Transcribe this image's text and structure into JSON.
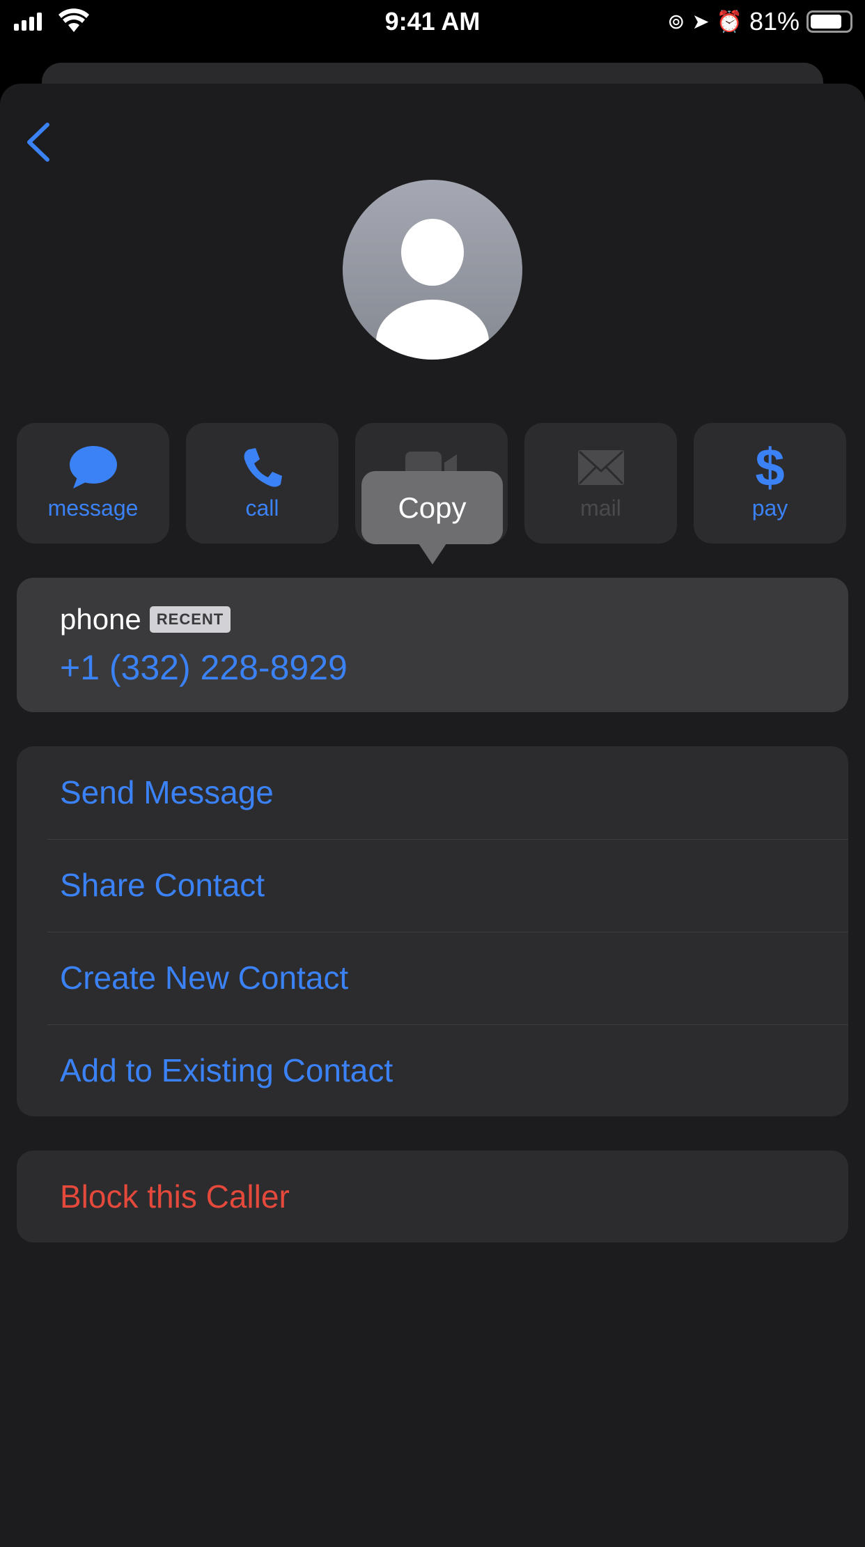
{
  "status_bar": {
    "time": "9:41 AM",
    "battery": "81%",
    "battery_level": 0.81
  },
  "actions": [
    {
      "label": "message",
      "icon": "message-bubble-icon",
      "enabled": true
    },
    {
      "label": "call",
      "icon": "phone-icon",
      "enabled": true
    },
    {
      "label": "video",
      "icon": "video-icon",
      "enabled": false
    },
    {
      "label": "mail",
      "icon": "envelope-icon",
      "enabled": false
    },
    {
      "label": "pay",
      "icon": "dollar-icon",
      "enabled": true
    }
  ],
  "tooltip": {
    "label": "Copy"
  },
  "phone": {
    "label": "phone",
    "badge": "RECENT",
    "number": "+1 (332) 228-8929"
  },
  "menu": [
    "Send Message",
    "Share Contact",
    "Create New Contact",
    "Add to Existing Contact"
  ],
  "danger": {
    "label": "Block this Caller"
  },
  "colors": {
    "accent": "#3b82f6",
    "danger": "#e5493c",
    "background": "#1c1c1e",
    "card": "#2c2c2e"
  }
}
